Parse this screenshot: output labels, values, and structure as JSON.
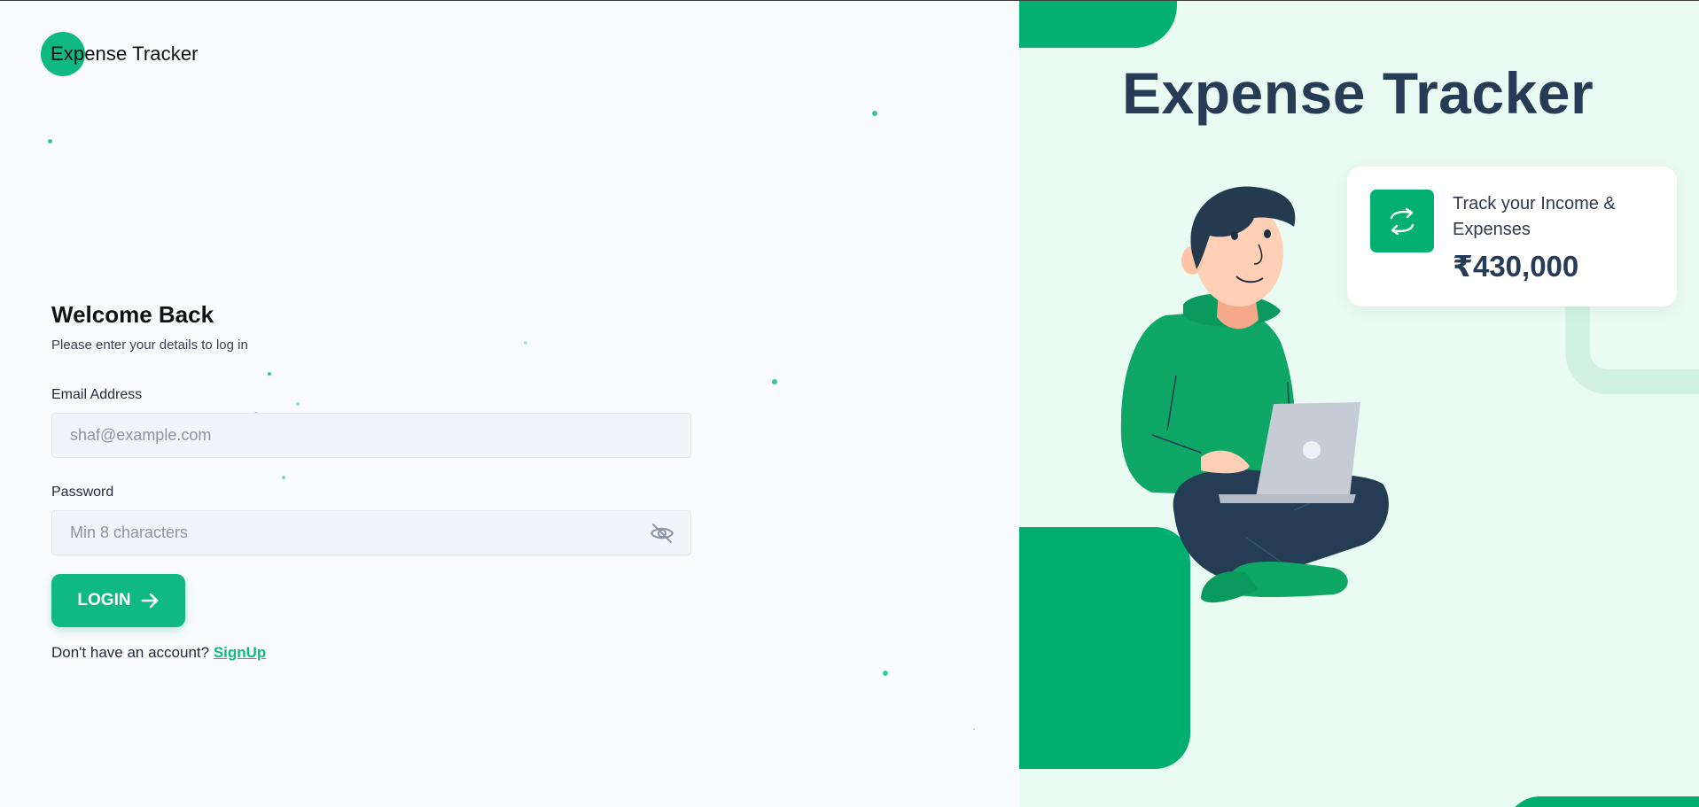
{
  "app": {
    "brand_name": "Expense Tracker"
  },
  "login_form": {
    "heading": "Welcome Back",
    "subtitle": "Please enter your details to log in",
    "email_label": "Email Address",
    "email_placeholder": "shaf@example.com",
    "email_value": "",
    "password_label": "Password",
    "password_placeholder": "Min 8 characters",
    "password_value": "",
    "password_toggle_icon": "eye-off-icon",
    "login_button_label": "LOGIN",
    "login_button_icon": "arrow-right-icon",
    "signup_prompt": "Don't have an account?",
    "signup_link_label": "SignUp"
  },
  "hero": {
    "title": "Expense Tracker",
    "stat_card": {
      "icon": "swap-arrows-icon",
      "label": "Track your Income & Expenses",
      "value": "₹430,000"
    }
  },
  "colors": {
    "accent": "#10b981",
    "accent_dark": "#03b072",
    "hero_background": "#e9fbf3",
    "heading_navy": "#263b55",
    "page_background": "#fafbfc"
  }
}
